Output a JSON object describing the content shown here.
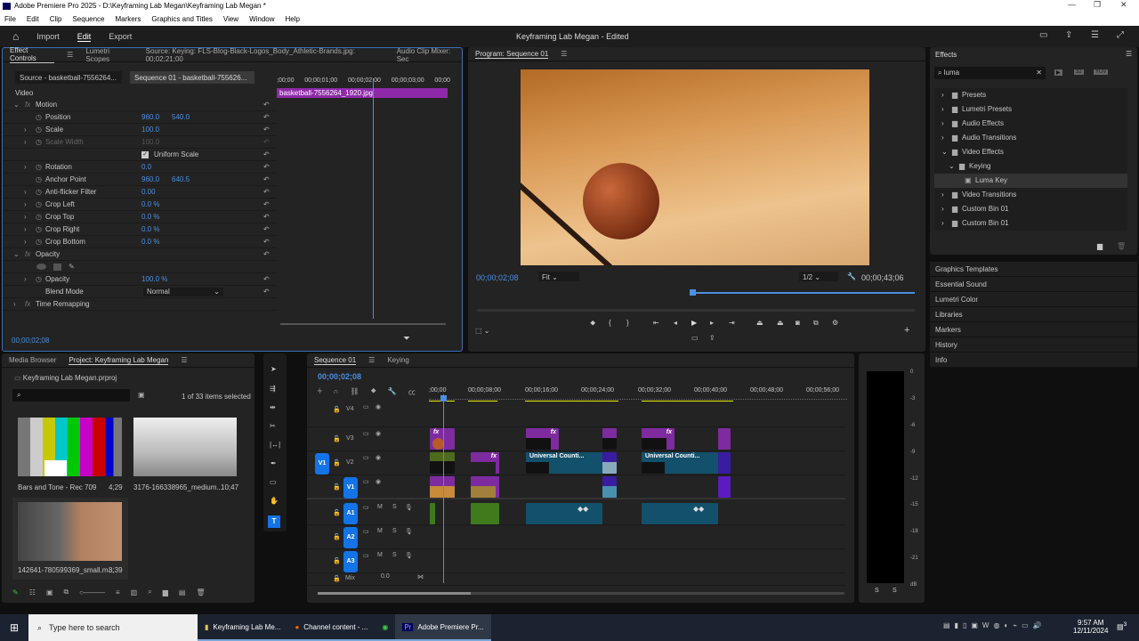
{
  "window": {
    "title": "Adobe Premiere Pro 2025 - D:\\Keyframing Lab Megan\\Keyframing Lab Megan *"
  },
  "menu": [
    "File",
    "Edit",
    "Clip",
    "Sequence",
    "Markers",
    "Graphics and Titles",
    "View",
    "Window",
    "Help"
  ],
  "header": {
    "import": "Import",
    "edit": "Edit",
    "export": "Export",
    "project_title": "Keyframing Lab Megan",
    "status": "- Edited"
  },
  "effect_controls": {
    "tabs": [
      "Effect Controls",
      "Lumetri Scopes",
      "Source: Keying: FLS-Blog-Black-Logos_Body_Athletic-Brands.jpg: 00;02;21;00",
      "Audio Clip Mixer: Sec"
    ],
    "source_btn": "Source - basketball-7556264...",
    "sequence_btn": "Sequence 01 - basketball-755626...",
    "ruler": [
      ";00;00",
      "00;00;01;00",
      "00;00;02;00",
      "00;00;03;00",
      "00;00"
    ],
    "clip_name": "basketball-7556264_1920.jpg",
    "section": "Video",
    "rows": [
      {
        "label": "Motion",
        "type": "fx"
      },
      {
        "label": "Position",
        "v1": "960.0",
        "v2": "540.0"
      },
      {
        "label": "Scale",
        "v1": "100.0"
      },
      {
        "label": "Scale Width",
        "v1": "100.0",
        "disabled": true
      },
      {
        "label": "Uniform Scale",
        "type": "checkbox",
        "checked": true
      },
      {
        "label": "Rotation",
        "v1": "0.0"
      },
      {
        "label": "Anchor Point",
        "v1": "960.0",
        "v2": "640.5"
      },
      {
        "label": "Anti-flicker Filter",
        "v1": "0.00"
      },
      {
        "label": "Crop Left",
        "v1": "0.0 %"
      },
      {
        "label": "Crop Top",
        "v1": "0.0 %"
      },
      {
        "label": "Crop Right",
        "v1": "0.0 %"
      },
      {
        "label": "Crop Bottom",
        "v1": "0.0 %"
      },
      {
        "label": "Opacity",
        "type": "fx"
      },
      {
        "label": "",
        "type": "masks"
      },
      {
        "label": "Opacity",
        "v1": "100.0 %"
      },
      {
        "label": "Blend Mode",
        "select": "Normal"
      },
      {
        "label": "Time Remapping",
        "type": "fx"
      }
    ],
    "timecode": "00;00;02;08"
  },
  "program": {
    "title": "Program: Sequence 01",
    "timecode": "00;00;02;08",
    "fit": "Fit",
    "resolution": "1/2",
    "duration": "00;00;43;06"
  },
  "effects": {
    "title": "Effects",
    "search": "luma",
    "tree": [
      {
        "label": "Presets"
      },
      {
        "label": "Lumetri Presets"
      },
      {
        "label": "Audio Effects"
      },
      {
        "label": "Audio Transitions"
      },
      {
        "label": "Video Effects",
        "open": true
      },
      {
        "label": "Keying",
        "open": true
      },
      {
        "label": "Luma Key",
        "selected": true
      },
      {
        "label": "Video Transitions"
      },
      {
        "label": "Custom Bin 01"
      },
      {
        "label": "Custom Bin 01"
      }
    ],
    "docked": [
      "Graphics Templates",
      "Essential Sound",
      "Lumetri Color",
      "Libraries",
      "Markers",
      "History",
      "Info"
    ]
  },
  "project": {
    "tabs": [
      "Media Browser",
      "Project: Keyframing Lab Megan"
    ],
    "file": "Keyframing Lab Megan.prproj",
    "selection": "1 of 33 items selected",
    "items": [
      {
        "name": "Bars and Tone - Rec 709",
        "dur": "4;29"
      },
      {
        "name": "3176-166338965_medium...",
        "dur": "10;47"
      },
      {
        "name": "142641-780599369_small.m...",
        "dur": "8;39"
      }
    ]
  },
  "timeline": {
    "tabs": [
      "Sequence 01",
      "Keying"
    ],
    "timecode": "00;00;02;08",
    "ruler": [
      ";00;00",
      "00;00;08;00",
      "00;00;16;00",
      "00;00;24;00",
      "00;00;32;00",
      "00;00;40;00",
      "00;00;48;00",
      "00;00;56;00"
    ],
    "tracks": [
      "V4",
      "V3",
      "V2",
      "V1",
      "A1",
      "A2",
      "A3"
    ],
    "source_patch": "V1",
    "mix": "Mix",
    "mix_value": "0.0",
    "clip_title": "Universal Counti...",
    "fx": "fx"
  },
  "meter": {
    "scale": [
      "0",
      "-3",
      "-6",
      "-9",
      "-12",
      "-15",
      "-18",
      "-21",
      "dB"
    ],
    "solo": [
      "S",
      "S"
    ]
  },
  "taskbar": {
    "search": "Type here to search",
    "apps": [
      "Keyframing Lab Me...",
      "Channel content - ...",
      "",
      "Adobe Premiere Pr..."
    ],
    "time": "9:57 AM",
    "date": "12/11/2024",
    "notifications": "3"
  }
}
